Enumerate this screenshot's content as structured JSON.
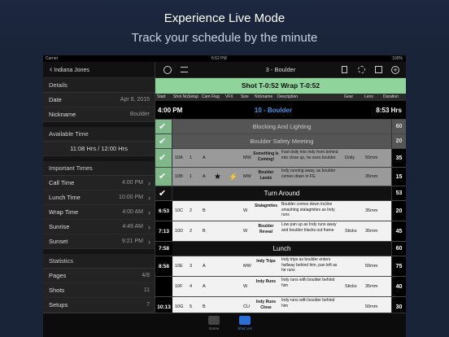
{
  "banner": {
    "title": "Experience Live Mode",
    "subtitle": "Track your schedule by the minute"
  },
  "status_bar": {
    "carrier": "Carrier",
    "time": "6:52 PM",
    "battery": "100%"
  },
  "sidebar": {
    "back_label": "Indiana Jones",
    "details_header": "Details",
    "date_label": "Date",
    "date_value": "Apr 8, 2015",
    "nickname_label": "Nickname",
    "nickname_value": "Boulder",
    "available_header": "Available Time",
    "available_value": "11:08 Hrs / 12:00 Hrs",
    "important_header": "Important Times",
    "times": [
      {
        "label": "Call Time",
        "value": "4:00 PM"
      },
      {
        "label": "Lunch Time",
        "value": "10:00 PM"
      },
      {
        "label": "Wrap Time",
        "value": "4:00 AM"
      },
      {
        "label": "Sunrise",
        "value": "4:49 AM"
      },
      {
        "label": "Sunset",
        "value": "9:21 PM"
      }
    ],
    "stats_header": "Statistics",
    "stats": [
      {
        "label": "Pages",
        "value": "4/8"
      },
      {
        "label": "Shots",
        "value": "11"
      },
      {
        "label": "Setups",
        "value": "7"
      }
    ]
  },
  "main": {
    "title": "3 - Boulder",
    "shot_status": "Shot T-0:52  Wrap T-0:52",
    "columns": [
      "Start",
      "Shot No.",
      "Setup",
      "Cam",
      "Flag",
      "VFX",
      "Size",
      "Nickname",
      "Description",
      "Gear",
      "Lens",
      "Duration"
    ],
    "day": {
      "start": "4:00 PM",
      "title": "10 - Boulder",
      "hours": "8:53 Hrs"
    },
    "rows": [
      {
        "kind": "grey",
        "label": "Blocking And Lighting",
        "dur": "60",
        "check": true
      },
      {
        "kind": "grey",
        "label": "Boulder Safety Meeting",
        "dur": "20",
        "check": true
      },
      {
        "kind": "shot",
        "check": true,
        "shot": "10A",
        "setup": "1",
        "cam": "A",
        "size": "MW",
        "nick": "Something Is Coming!",
        "desc": "Fast dolly into Indy from behind into close up, he sees boulder.",
        "gear": "Dolly",
        "lens": "50mm",
        "dur": "35"
      },
      {
        "kind": "shot",
        "check": true,
        "shot": "10B",
        "setup": "1",
        "cam": "A",
        "flag": "★",
        "vfx": "⚡",
        "size": "MW",
        "nick": "Boulder Lands",
        "desc": "Indy running away, as boulder comes down in FG",
        "gear": "",
        "lens": "35mm",
        "dur": "15"
      },
      {
        "kind": "dark",
        "check": true,
        "label": "Turn Around",
        "dur": "53"
      },
      {
        "kind": "white",
        "time": "6:53",
        "shot": "10C",
        "setup": "2",
        "cam": "B",
        "size": "W",
        "nick": "Stalagmites",
        "desc": "Boulder comes down incline smashing stalagmites as Indy runs",
        "gear": "",
        "lens": "35mm",
        "dur": "20"
      },
      {
        "kind": "white",
        "time": "7:13",
        "shot": "10D",
        "setup": "2",
        "cam": "B",
        "size": "W",
        "nick": "Boulder Reveal",
        "desc": "Low pan up as Indy runs away and boulder blacks out frame",
        "gear": "Sticks",
        "lens": "35mm",
        "dur": "45"
      },
      {
        "kind": "dark",
        "time": "7:58",
        "label": "Lunch",
        "dur": "60"
      },
      {
        "kind": "white",
        "time": "8:58",
        "shot": "10E",
        "setup": "3",
        "cam": "A",
        "size": "MW",
        "nick": "Indy Trips",
        "desc": "Indy trips as boulder enters hallway behind him, pan left as he runs",
        "gear": "",
        "lens": "50mm",
        "dur": "75"
      },
      {
        "kind": "white",
        "time": "",
        "shot": "10F",
        "setup": "4",
        "cam": "A",
        "size": "W",
        "nick": "Indy Runs",
        "desc": "Indy runs with boulder behind him",
        "gear": "Sticks",
        "lens": "35mm",
        "dur": "40"
      },
      {
        "kind": "white",
        "time": "10:13",
        "shot": "10G",
        "setup": "5",
        "cam": "B",
        "size": "CU",
        "nick": "Indy Runs Close",
        "desc": "Indy runs with boulder behind him",
        "gear": "",
        "lens": "50mm",
        "dur": "30"
      }
    ]
  },
  "tabbar": {
    "tabs": [
      "Scene",
      "Shot List"
    ]
  }
}
